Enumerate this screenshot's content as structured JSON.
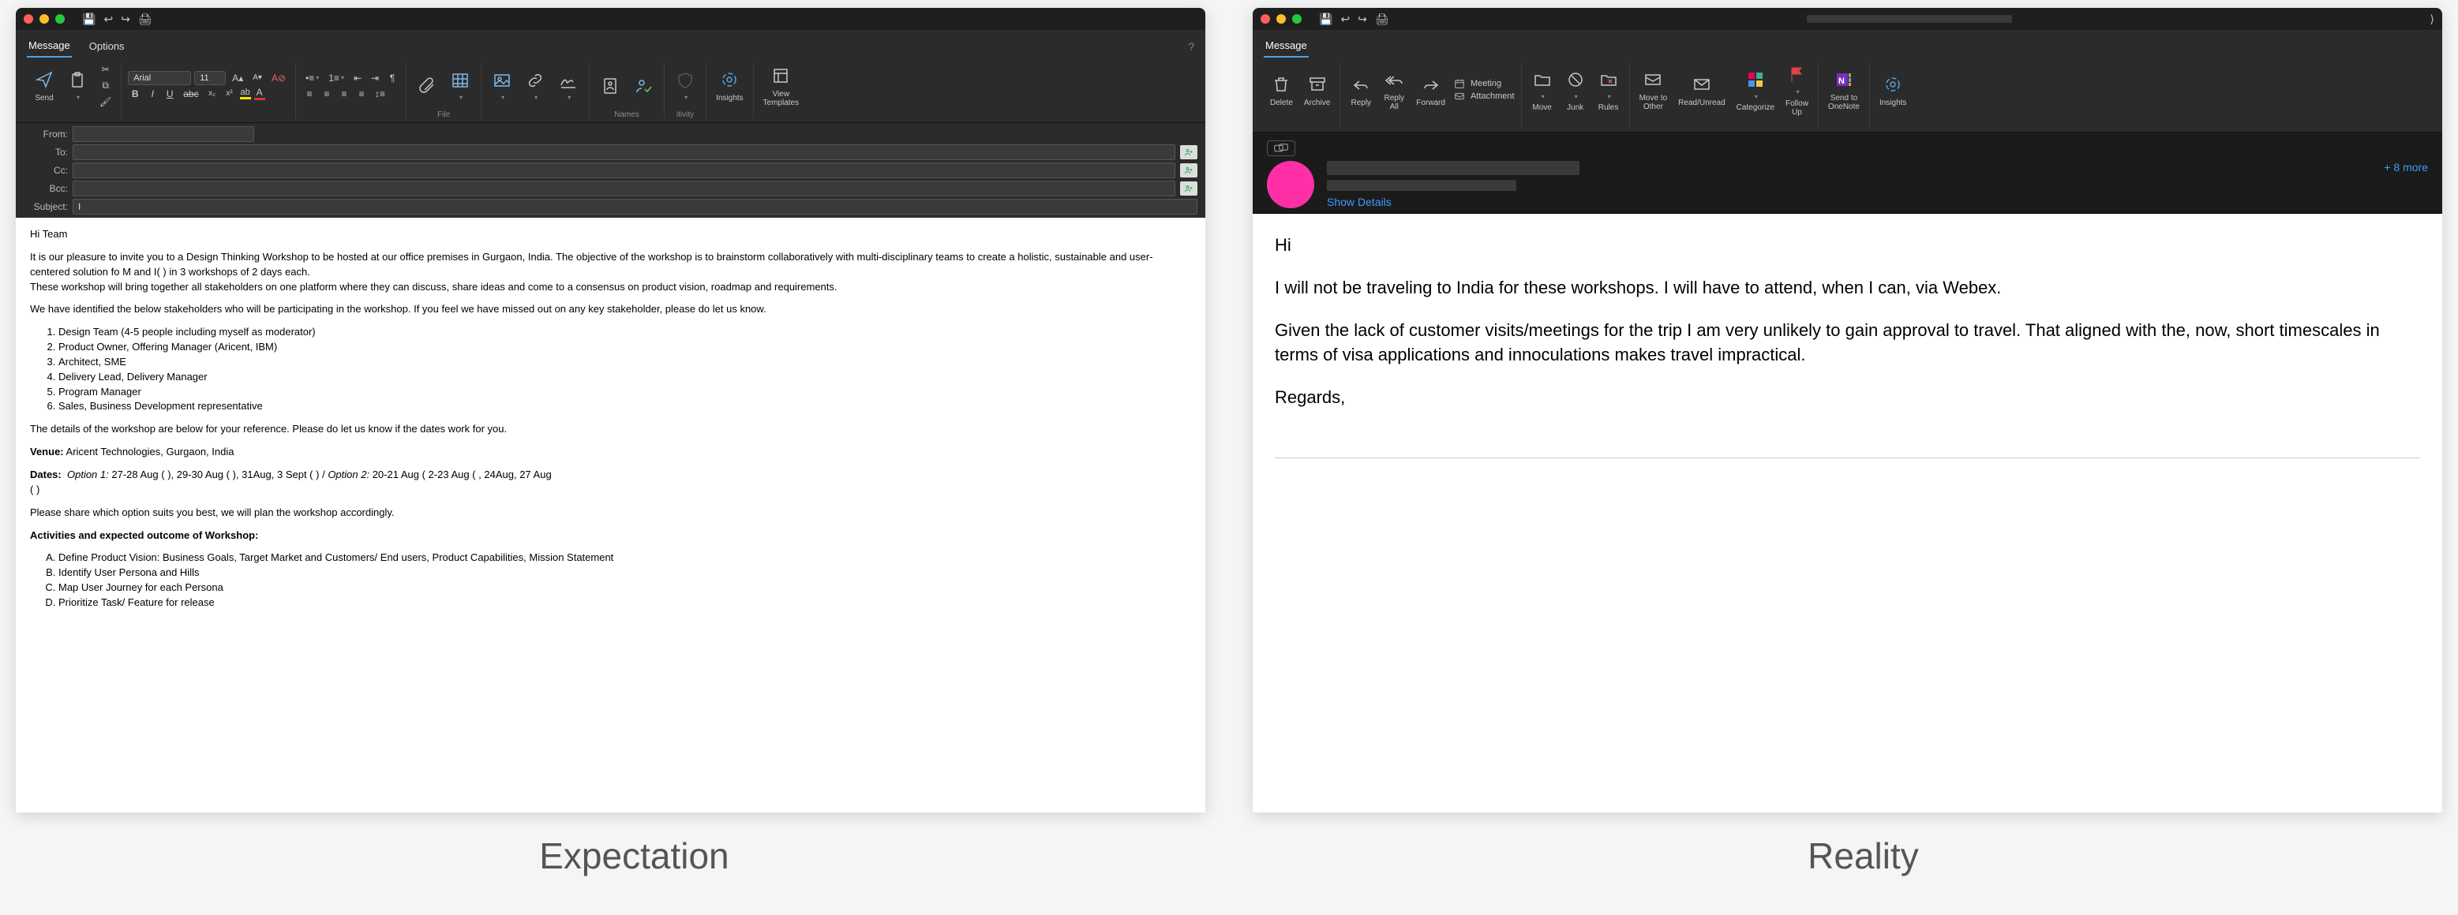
{
  "captions": {
    "left": "Expectation",
    "right": "Reality"
  },
  "compose": {
    "tabs": {
      "message": "Message",
      "options": "Options"
    },
    "send_label": "Send",
    "font_name": "Arial",
    "font_size": "11",
    "group_labels": {
      "file": "File",
      "names": "Names",
      "ivity": "itivity",
      "insights": "Insights",
      "view_templates": "View\nTemplates"
    },
    "headers": {
      "from": "From:",
      "to": "To:",
      "cc": "Cc:",
      "bcc": "Bcc:",
      "subject": "Subject:",
      "subject_value": "I"
    },
    "body": {
      "greeting": "Hi Team",
      "p1a": "It is our pleasure to invite you to a Design Thinking Workshop to be hosted at our office premises in Gurgaon, India. The objective of the workshop is to brainstorm collaboratively with multi-disciplinary teams to create a holistic, sustainable and user-centered solution fo",
      "p1mask1": "          ",
      "p1b": "M and I(",
      "p1mask2": "                 ",
      "p1c": ") in 3 workshops of 2 days each.",
      "p1d": "These workshop will bring together all stakeholders on one platform where they can discuss, share ideas and come to a consensus on product vision, roadmap and requirements.",
      "p2": "We have identified the below stakeholders who will be participating in the workshop. If you feel we have missed out on any key stakeholder, please do let us know.",
      "list": [
        "Design Team (4-5 people including myself as moderator)",
        "Product Owner, Offering Manager (Aricent, IBM)",
        "Architect, SME",
        "Delivery Lead, Delivery Manager",
        "Program Manager",
        "Sales, Business Development representative"
      ],
      "p3": "The details of the workshop are below for your reference. Please do let us know if the dates work for you.",
      "venue_label": "Venue:",
      "venue": " Aricent Technologies, Gurgaon, India",
      "dates_label": "Dates:",
      "opt1_label": "Option 1:",
      "opt1a": " 27-28 Aug (",
      "opt1b": "), 29-30 Aug (",
      "opt1c": "), 31Aug, 3 Sept (",
      "opt1d": ") / ",
      "opt2_label": "Option 2:",
      "opt2a": " 20-21 Aug (",
      "opt2b": "2-23 Aug (",
      "opt2c": ", 24Aug, 27 Aug",
      "opt_tail_paren": "(",
      "opt_tail_close": ")",
      "p4": "Please share which option suits you best, we will plan the workshop accordingly.",
      "activities_label": "Activities and expected outcome of Workshop:",
      "lettered": [
        "Define Product Vision: Business Goals, Target Market and Customers/ End users, Product Capabilities, Mission Statement",
        "Identify User Persona and Hills",
        "Map User Journey for each Persona",
        "Prioritize Task/ Feature for release"
      ]
    }
  },
  "read": {
    "tab": "Message",
    "ribbon": {
      "delete": "Delete",
      "archive": "Archive",
      "reply": "Reply",
      "reply_all": "Reply\nAll",
      "forward": "Forward",
      "meeting": "Meeting",
      "attachment": "Attachment",
      "move": "Move",
      "junk": "Junk",
      "rules": "Rules",
      "move_to_other": "Move to\nOther",
      "read_unread": "Read/Unread",
      "categorize": "Categorize",
      "follow_up": "Follow\nUp",
      "send_to_onenote": "Send to\nOneNote",
      "insights": "Insights"
    },
    "more": "+ 8 more",
    "show_details": "Show Details",
    "body": {
      "hi": "Hi",
      "p1": "I will not be traveling to India for these workshops. I will have to attend, when I can, via Webex.",
      "p2": "Given the lack of customer visits/meetings for the trip I am very unlikely to gain approval to travel. That aligned with the, now, short timescales in terms of visa applications and innoculations makes travel impractical.",
      "regards": "Regards,"
    }
  }
}
